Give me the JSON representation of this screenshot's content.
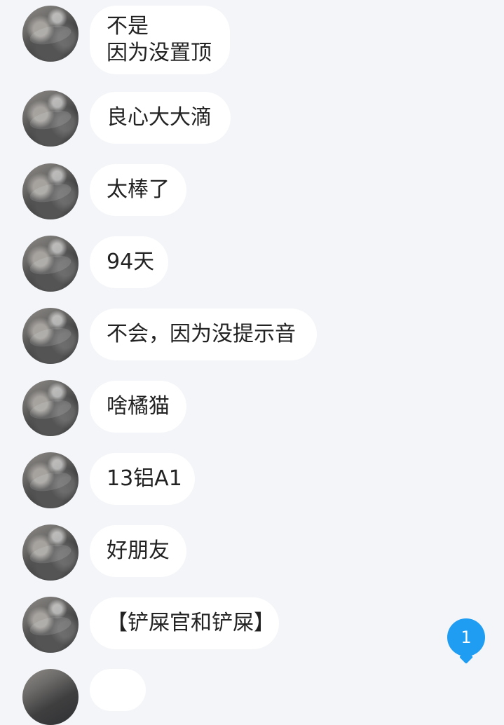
{
  "messages": [
    {
      "lines": [
        "不是",
        "因为没置顶"
      ]
    },
    {
      "lines": [
        "良心大大滴"
      ]
    },
    {
      "lines": [
        "太棒了"
      ]
    },
    {
      "lines": [
        "94天"
      ]
    },
    {
      "lines": [
        "不会，因为没提示音"
      ]
    },
    {
      "lines": [
        "啥橘猫"
      ]
    },
    {
      "lines": [
        "13铝A1"
      ]
    },
    {
      "lines": [
        "好朋友"
      ]
    },
    {
      "lines": [
        "【铲屎官和铲屎】"
      ]
    }
  ],
  "unread_badge": {
    "count": "1",
    "color": "#1e9df2"
  },
  "theme": {
    "background": "#f3f5f8",
    "bubble": "#ffffff",
    "text": "#222222"
  }
}
